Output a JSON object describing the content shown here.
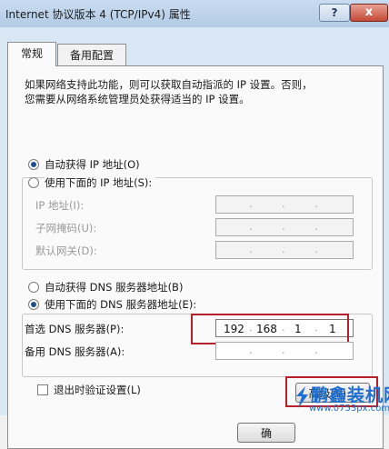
{
  "window": {
    "title": "Internet 协议版本 4 (TCP/IPv4) 属性",
    "help": "?",
    "close": "x"
  },
  "tabs": [
    {
      "label": "常规"
    },
    {
      "label": "备用配置"
    }
  ],
  "description": [
    "如果网络支持此功能，则可以获取自动指派的 IP 设置。否则，",
    "您需要从网络系统管理员处获得适当的 IP 设置。"
  ],
  "ip_section": {
    "auto_label": "自动获得 IP 地址(O)",
    "manual_label": "使用下面的 IP 地址(S):",
    "fields": [
      {
        "label": "IP 地址(I):",
        "octets": [
          "",
          "",
          "",
          ""
        ]
      },
      {
        "label": "子网掩码(U):",
        "octets": [
          "",
          "",
          "",
          ""
        ]
      },
      {
        "label": "默认网关(D):",
        "octets": [
          "",
          "",
          "",
          ""
        ]
      }
    ]
  },
  "dns_section": {
    "auto_label": "自动获得 DNS 服务器地址(B)",
    "manual_label": "使用下面的 DNS 服务器地址(E):",
    "preferred": {
      "label": "首选 DNS 服务器(P):",
      "octets": [
        "192",
        "168",
        "1",
        "1"
      ]
    },
    "alternate": {
      "label": "备用 DNS 服务器(A):",
      "octets": [
        "",
        "",
        "",
        ""
      ]
    }
  },
  "validate_label": "退出时验证设置(L)",
  "advanced_button": "高级(V)...",
  "ok_button": "确",
  "watermark": {
    "brand": "鹏鑫装机网",
    "url": "www.0753px.com"
  },
  "colors": {
    "highlight_box": "#b5202a",
    "radio_selected": "#1f4f8f",
    "watermark": "#1f6fd0"
  }
}
